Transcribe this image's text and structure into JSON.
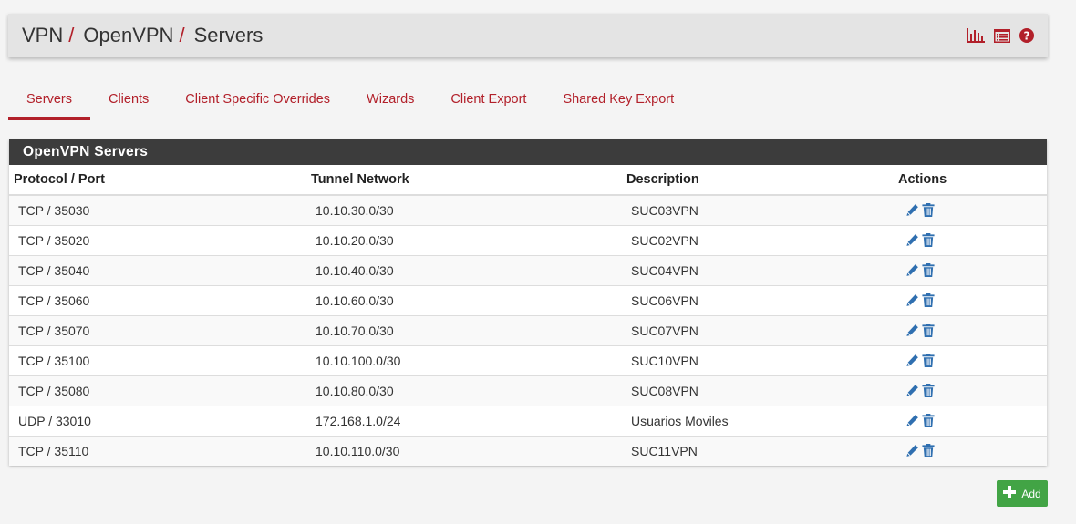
{
  "breadcrumb": {
    "items": [
      "VPN",
      "OpenVPN",
      "Servers"
    ],
    "separator": "/"
  },
  "header_icons": [
    "bar-chart-icon",
    "list-icon",
    "help-icon"
  ],
  "tabs": [
    {
      "label": "Servers",
      "active": true
    },
    {
      "label": "Clients"
    },
    {
      "label": "Client Specific Overrides"
    },
    {
      "label": "Wizards"
    },
    {
      "label": "Client Export"
    },
    {
      "label": "Shared Key Export"
    }
  ],
  "panel": {
    "title": "OpenVPN Servers",
    "columns": [
      "Protocol / Port",
      "Tunnel Network",
      "Description",
      "Actions"
    ],
    "rows": [
      {
        "protocol_port": "TCP / 35030",
        "tunnel": "10.10.30.0/30",
        "description": "SUC03VPN"
      },
      {
        "protocol_port": "TCP / 35020",
        "tunnel": "10.10.20.0/30",
        "description": "SUC02VPN"
      },
      {
        "protocol_port": "TCP / 35040",
        "tunnel": "10.10.40.0/30",
        "description": "SUC04VPN"
      },
      {
        "protocol_port": "TCP / 35060",
        "tunnel": "10.10.60.0/30",
        "description": "SUC06VPN"
      },
      {
        "protocol_port": "TCP / 35070",
        "tunnel": "10.10.70.0/30",
        "description": "SUC07VPN"
      },
      {
        "protocol_port": "TCP / 35100",
        "tunnel": "10.10.100.0/30",
        "description": "SUC10VPN"
      },
      {
        "protocol_port": "TCP / 35080",
        "tunnel": "10.10.80.0/30",
        "description": "SUC08VPN"
      },
      {
        "protocol_port": "UDP / 33010",
        "tunnel": "172.168.1.0/24",
        "description": "Usuarios Moviles"
      },
      {
        "protocol_port": "TCP / 35110",
        "tunnel": "10.10.110.0/30",
        "description": "SUC11VPN"
      }
    ]
  },
  "add_button": {
    "label": "Add",
    "icon": "plus-icon"
  },
  "colors": {
    "accent": "#b2202a",
    "heading_bg": "#3c3c3c",
    "action_icon": "#2f6fb0",
    "add_green": "#42a445"
  }
}
